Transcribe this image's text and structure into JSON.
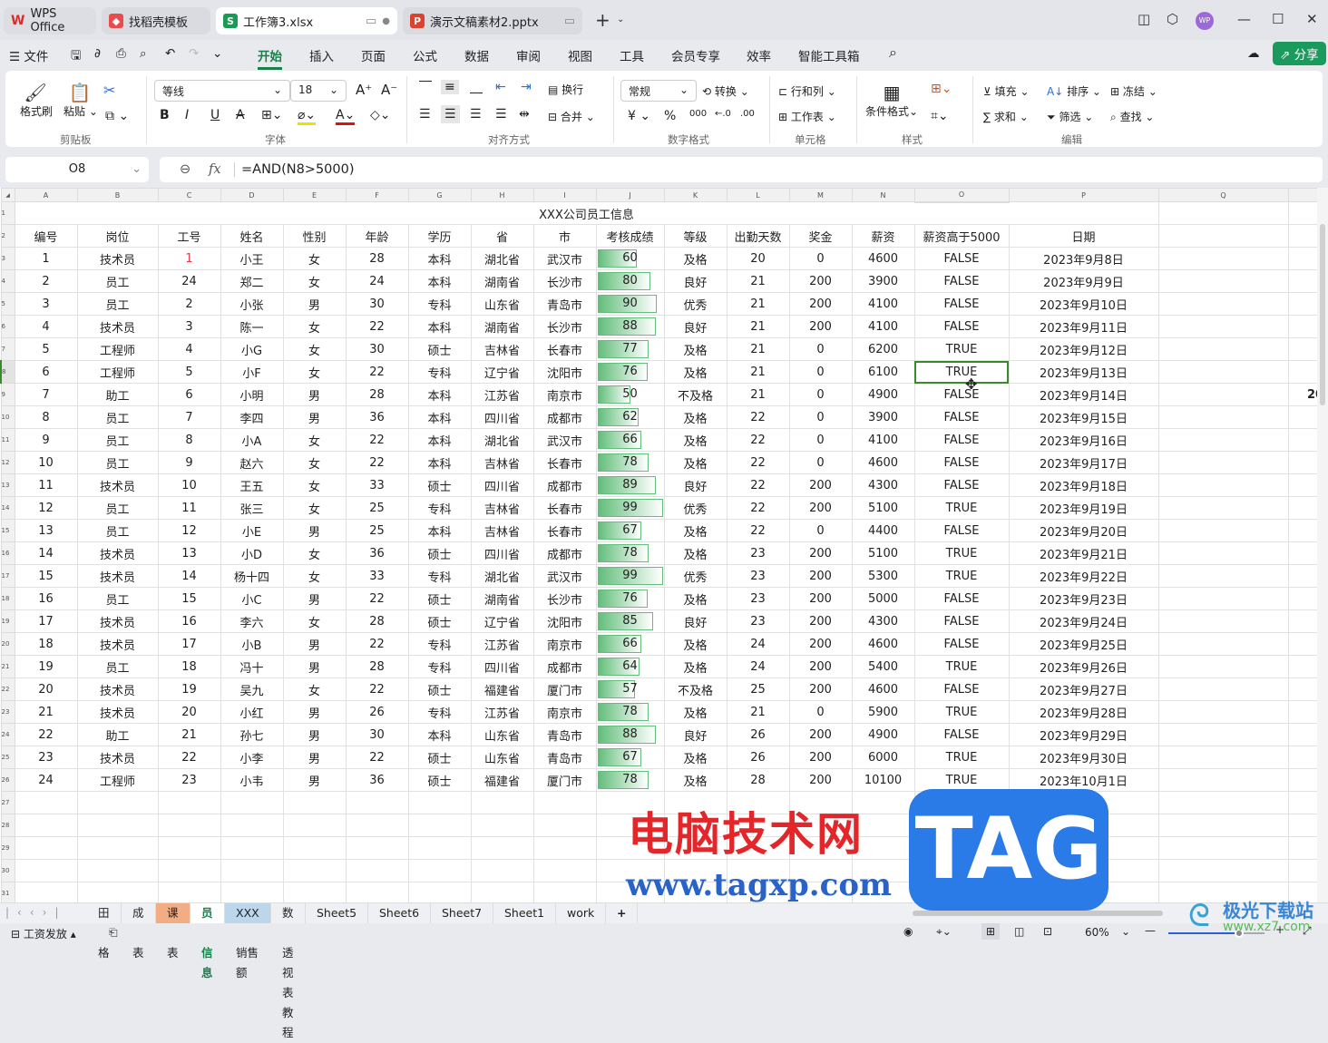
{
  "titlebar": {
    "tabs": [
      {
        "label": "WPS Office",
        "icon": "wps-logo-icon",
        "color": "#e02a2a"
      },
      {
        "label": "找稻壳模板",
        "icon": "docer-icon",
        "color": "#e84c4c"
      },
      {
        "label": "工作簿3.xlsx",
        "icon": "spreadsheet-icon",
        "color": "#1a9a54",
        "glyph": "S"
      },
      {
        "label": "演示文稿素材2.pptx",
        "icon": "presentation-icon",
        "color": "#d9432f",
        "glyph": "P"
      }
    ],
    "new_tab": "+",
    "avatar": "WP"
  },
  "menubar": {
    "file": "文件",
    "tabs": [
      "开始",
      "插入",
      "页面",
      "公式",
      "数据",
      "审阅",
      "视图",
      "工具",
      "会员专享",
      "效率",
      "智能工具箱"
    ],
    "active": "开始",
    "share": "分享"
  },
  "ribbon": {
    "clipboard": {
      "format_painter": "格式刷",
      "paste": "粘贴",
      "group": "剪贴板"
    },
    "font": {
      "name": "等线",
      "size": "18",
      "group": "字体"
    },
    "align": {
      "wrap": "换行",
      "merge": "合并",
      "group": "对齐方式"
    },
    "number": {
      "format": "常规",
      "convert": "转换",
      "group": "数字格式"
    },
    "cells": {
      "rowcol": "行和列",
      "worksheet": "工作表",
      "group": "单元格"
    },
    "styles": {
      "conditional": "条件格式",
      "group": "样式"
    },
    "edit": {
      "fill": "填充",
      "sort": "排序",
      "freeze": "冻结",
      "sum": "求和",
      "filter": "筛选",
      "find": "查找",
      "group": "编辑"
    }
  },
  "formula_bar": {
    "cell": "O8",
    "formula": "=AND(N8>5000)",
    "fx": "fx"
  },
  "sheet": {
    "columns": [
      "A",
      "B",
      "C",
      "D",
      "E",
      "F",
      "G",
      "H",
      "I",
      "J",
      "K",
      "L",
      "M",
      "N",
      "O",
      "P",
      "Q",
      ""
    ],
    "selected_column": "O",
    "selected_row": 8,
    "title": "XXX公司员工信息",
    "headers": [
      "编号",
      "岗位",
      "工号",
      "姓名",
      "性别",
      "年龄",
      "学历",
      "省",
      "市",
      "考核成绩",
      "等级",
      "出勤天数",
      "奖金",
      "薪资",
      "薪资高于5000",
      "日期"
    ],
    "rows": [
      [
        "1",
        "技术员",
        "1",
        "小王",
        "女",
        "28",
        "本科",
        "湖北省",
        "武汉市",
        "60",
        "及格",
        "20",
        "0",
        "4600",
        "FALSE",
        "2023年9月8日"
      ],
      [
        "2",
        "员工",
        "24",
        "郑二",
        "女",
        "24",
        "本科",
        "湖南省",
        "长沙市",
        "80",
        "良好",
        "21",
        "200",
        "3900",
        "FALSE",
        "2023年9月9日"
      ],
      [
        "3",
        "员工",
        "2",
        "小张",
        "男",
        "30",
        "专科",
        "山东省",
        "青岛市",
        "90",
        "优秀",
        "21",
        "200",
        "4100",
        "FALSE",
        "2023年9月10日"
      ],
      [
        "4",
        "技术员",
        "3",
        "陈一",
        "女",
        "22",
        "本科",
        "湖南省",
        "长沙市",
        "88",
        "良好",
        "21",
        "200",
        "4100",
        "FALSE",
        "2023年9月11日"
      ],
      [
        "5",
        "工程师",
        "4",
        "小G",
        "女",
        "30",
        "硕士",
        "吉林省",
        "长春市",
        "77",
        "及格",
        "21",
        "0",
        "6200",
        "TRUE",
        "2023年9月12日"
      ],
      [
        "6",
        "工程师",
        "5",
        "小F",
        "女",
        "22",
        "专科",
        "辽宁省",
        "沈阳市",
        "76",
        "及格",
        "21",
        "0",
        "6100",
        "TRUE",
        "2023年9月13日"
      ],
      [
        "7",
        "助工",
        "6",
        "小明",
        "男",
        "28",
        "本科",
        "江苏省",
        "南京市",
        "50",
        "不及格",
        "21",
        "0",
        "4900",
        "FALSE",
        "2023年9月14日"
      ],
      [
        "8",
        "员工",
        "7",
        "李四",
        "男",
        "36",
        "本科",
        "四川省",
        "成都市",
        "62",
        "及格",
        "22",
        "0",
        "3900",
        "FALSE",
        "2023年9月15日"
      ],
      [
        "9",
        "员工",
        "8",
        "小A",
        "女",
        "22",
        "本科",
        "湖北省",
        "武汉市",
        "66",
        "及格",
        "22",
        "0",
        "4100",
        "FALSE",
        "2023年9月16日"
      ],
      [
        "10",
        "员工",
        "9",
        "赵六",
        "女",
        "22",
        "本科",
        "吉林省",
        "长春市",
        "78",
        "及格",
        "22",
        "0",
        "4600",
        "FALSE",
        "2023年9月17日"
      ],
      [
        "11",
        "技术员",
        "10",
        "王五",
        "女",
        "33",
        "硕士",
        "四川省",
        "成都市",
        "89",
        "良好",
        "22",
        "200",
        "4300",
        "FALSE",
        "2023年9月18日"
      ],
      [
        "12",
        "员工",
        "11",
        "张三",
        "女",
        "25",
        "专科",
        "吉林省",
        "长春市",
        "99",
        "优秀",
        "22",
        "200",
        "5100",
        "TRUE",
        "2023年9月19日"
      ],
      [
        "13",
        "员工",
        "12",
        "小E",
        "男",
        "25",
        "本科",
        "吉林省",
        "长春市",
        "67",
        "及格",
        "22",
        "0",
        "4400",
        "FALSE",
        "2023年9月20日"
      ],
      [
        "14",
        "技术员",
        "13",
        "小D",
        "女",
        "36",
        "硕士",
        "四川省",
        "成都市",
        "78",
        "及格",
        "23",
        "200",
        "5100",
        "TRUE",
        "2023年9月21日"
      ],
      [
        "15",
        "技术员",
        "14",
        "杨十四",
        "女",
        "33",
        "专科",
        "湖北省",
        "武汉市",
        "99",
        "优秀",
        "23",
        "200",
        "5300",
        "TRUE",
        "2023年9月22日"
      ],
      [
        "16",
        "员工",
        "15",
        "小C",
        "男",
        "22",
        "硕士",
        "湖南省",
        "长沙市",
        "76",
        "及格",
        "23",
        "200",
        "5000",
        "FALSE",
        "2023年9月23日"
      ],
      [
        "17",
        "技术员",
        "16",
        "李六",
        "女",
        "28",
        "硕士",
        "辽宁省",
        "沈阳市",
        "85",
        "良好",
        "23",
        "200",
        "4300",
        "FALSE",
        "2023年9月24日"
      ],
      [
        "18",
        "技术员",
        "17",
        "小B",
        "男",
        "22",
        "专科",
        "江苏省",
        "南京市",
        "66",
        "及格",
        "24",
        "200",
        "4600",
        "FALSE",
        "2023年9月25日"
      ],
      [
        "19",
        "员工",
        "18",
        "冯十",
        "男",
        "28",
        "专科",
        "四川省",
        "成都市",
        "64",
        "及格",
        "24",
        "200",
        "5400",
        "TRUE",
        "2023年9月26日"
      ],
      [
        "20",
        "技术员",
        "19",
        "吴九",
        "女",
        "22",
        "硕士",
        "福建省",
        "厦门市",
        "57",
        "不及格",
        "25",
        "200",
        "4600",
        "FALSE",
        "2023年9月27日"
      ],
      [
        "21",
        "技术员",
        "20",
        "小红",
        "男",
        "26",
        "专科",
        "江苏省",
        "南京市",
        "78",
        "及格",
        "21",
        "0",
        "5900",
        "TRUE",
        "2023年9月28日"
      ],
      [
        "22",
        "助工",
        "21",
        "孙七",
        "男",
        "30",
        "本科",
        "山东省",
        "青岛市",
        "88",
        "良好",
        "26",
        "200",
        "4900",
        "FALSE",
        "2023年9月29日"
      ],
      [
        "23",
        "技术员",
        "22",
        "小李",
        "男",
        "22",
        "硕士",
        "山东省",
        "青岛市",
        "67",
        "及格",
        "26",
        "200",
        "6000",
        "TRUE",
        "2023年9月30日"
      ],
      [
        "24",
        "工程师",
        "23",
        "小韦",
        "男",
        "36",
        "硕士",
        "福建省",
        "厦门市",
        "78",
        "及格",
        "28",
        "200",
        "10100",
        "TRUE",
        "2023年10月1日"
      ]
    ],
    "clipped_text": "20",
    "databar_color": "#63be7b",
    "red_value_color": "#e8364a"
  },
  "sheet_tabs": {
    "tabs": [
      {
        "label": "田字格",
        "bg": ""
      },
      {
        "label": "成绩表",
        "bg": ""
      },
      {
        "label": "课程表",
        "bg": "#f3ad84"
      },
      {
        "label": "员工信息",
        "bg": "#ffffff",
        "active": true
      },
      {
        "label": "XXX公司销售额",
        "bg": "#bcd6ec"
      },
      {
        "label": "数据透视表教程",
        "bg": ""
      },
      {
        "label": "Sheet5",
        "bg": ""
      },
      {
        "label": "Sheet6",
        "bg": ""
      },
      {
        "label": "Sheet7",
        "bg": ""
      },
      {
        "label": "Sheet1",
        "bg": ""
      },
      {
        "label": "work",
        "bg": ""
      }
    ],
    "add": "+"
  },
  "status": {
    "left": "工资发放",
    "zoom": "60%",
    "zoom_level": 60
  },
  "watermarks": {
    "cn": "电脑技术网",
    "tag": "TAG",
    "url": "www.tagxp.com",
    "xz7_name": "极光下载站",
    "xz7_url": "www.xz7.com"
  }
}
